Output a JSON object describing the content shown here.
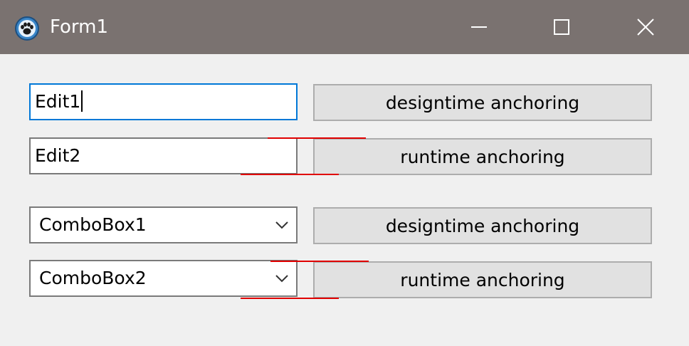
{
  "window": {
    "title": "Form1",
    "icon": "paw-icon",
    "controls": [
      "minimize-icon",
      "maximize-icon",
      "close-icon"
    ]
  },
  "form": {
    "edit1": {
      "value": "Edit1",
      "focused": true
    },
    "edit2": {
      "value": "Edit2"
    },
    "button1": {
      "label": "designtime anchoring"
    },
    "button2": {
      "label": "runtime anchoring"
    },
    "combobox1": {
      "value": "ComboBox1"
    },
    "combobox2": {
      "value": "ComboBox2"
    },
    "button3": {
      "label": "designtime anchoring"
    },
    "button4": {
      "label": "runtime anchoring"
    }
  },
  "colors": {
    "titlebar": "#7a7270",
    "background": "#f0f0f0",
    "focus_border": "#0078d7",
    "anchor_marker": "#e00000"
  }
}
